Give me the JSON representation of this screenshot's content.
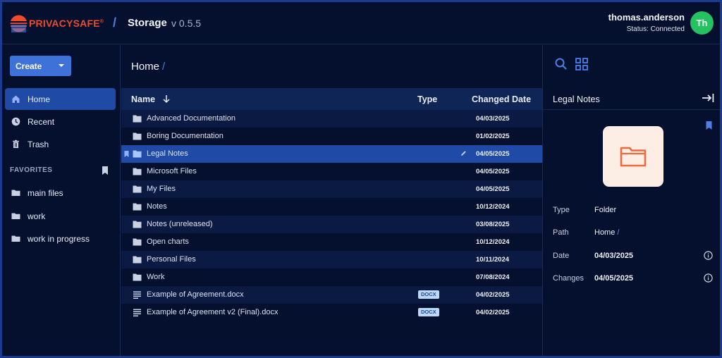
{
  "header": {
    "brand": "PRIVACYSAFE",
    "brand_mark": "®",
    "separator": "/",
    "app_name": "Storage",
    "version": "v 0.5.5",
    "user_name": "thomas.anderson",
    "user_status": "Status: Connected",
    "avatar_initials": "Th"
  },
  "sidebar": {
    "create_label": "Create",
    "nav": [
      {
        "label": "Home",
        "icon": "home-icon"
      },
      {
        "label": "Recent",
        "icon": "clock-icon"
      },
      {
        "label": "Trash",
        "icon": "trash-icon"
      }
    ],
    "favorites_header": "FAVORITES",
    "favorites": [
      {
        "label": "main files"
      },
      {
        "label": "work"
      },
      {
        "label": "work in progress"
      }
    ]
  },
  "main": {
    "breadcrumb": "Home",
    "breadcrumb_sep": "/",
    "columns": {
      "name": "Name",
      "type": "Type",
      "changed": "Changed Date"
    },
    "rows": [
      {
        "name": "Advanced Documentation",
        "date": "04/03/2025",
        "kind": "folder",
        "badge": ""
      },
      {
        "name": "Boring Documentation",
        "date": "01/02/2025",
        "kind": "folder",
        "badge": ""
      },
      {
        "name": "Legal Notes",
        "date": "04/05/2025",
        "kind": "folder",
        "badge": "",
        "selected": true
      },
      {
        "name": "Microsoft Files",
        "date": "04/05/2025",
        "kind": "folder",
        "badge": ""
      },
      {
        "name": "My Files",
        "date": "04/05/2025",
        "kind": "folder",
        "badge": ""
      },
      {
        "name": "Notes",
        "date": "10/12/2024",
        "kind": "folder",
        "badge": ""
      },
      {
        "name": "Notes (unreleased)",
        "date": "03/08/2025",
        "kind": "folder",
        "badge": ""
      },
      {
        "name": "Open charts",
        "date": "10/12/2024",
        "kind": "folder",
        "badge": ""
      },
      {
        "name": "Personal Files",
        "date": "10/11/2024",
        "kind": "folder",
        "badge": ""
      },
      {
        "name": "Work",
        "date": "07/08/2024",
        "kind": "folder",
        "badge": ""
      },
      {
        "name": "Example of Agreement.docx",
        "date": "04/02/2025",
        "kind": "doc",
        "badge": "DOCX"
      },
      {
        "name": "Example of Agreement v2 (Final).docx",
        "date": "04/02/2025",
        "kind": "doc",
        "badge": "DOCX"
      }
    ]
  },
  "details": {
    "title": "Legal Notes",
    "props": [
      {
        "label": "Type",
        "value": "Folder"
      },
      {
        "label": "Path",
        "value": "Home",
        "sep": "/"
      },
      {
        "label": "Date",
        "value": "04/03/2025"
      },
      {
        "label": "Changes",
        "value": "04/05/2025"
      }
    ]
  },
  "colors": {
    "background": "#05102e",
    "accent": "#3f72d8",
    "selected": "#1f4aa6",
    "brand": "#ee4a2c",
    "avatar": "#26c160",
    "folder_thumb_bg": "#fdeee5",
    "folder_thumb_icon": "#ee6a3c"
  }
}
